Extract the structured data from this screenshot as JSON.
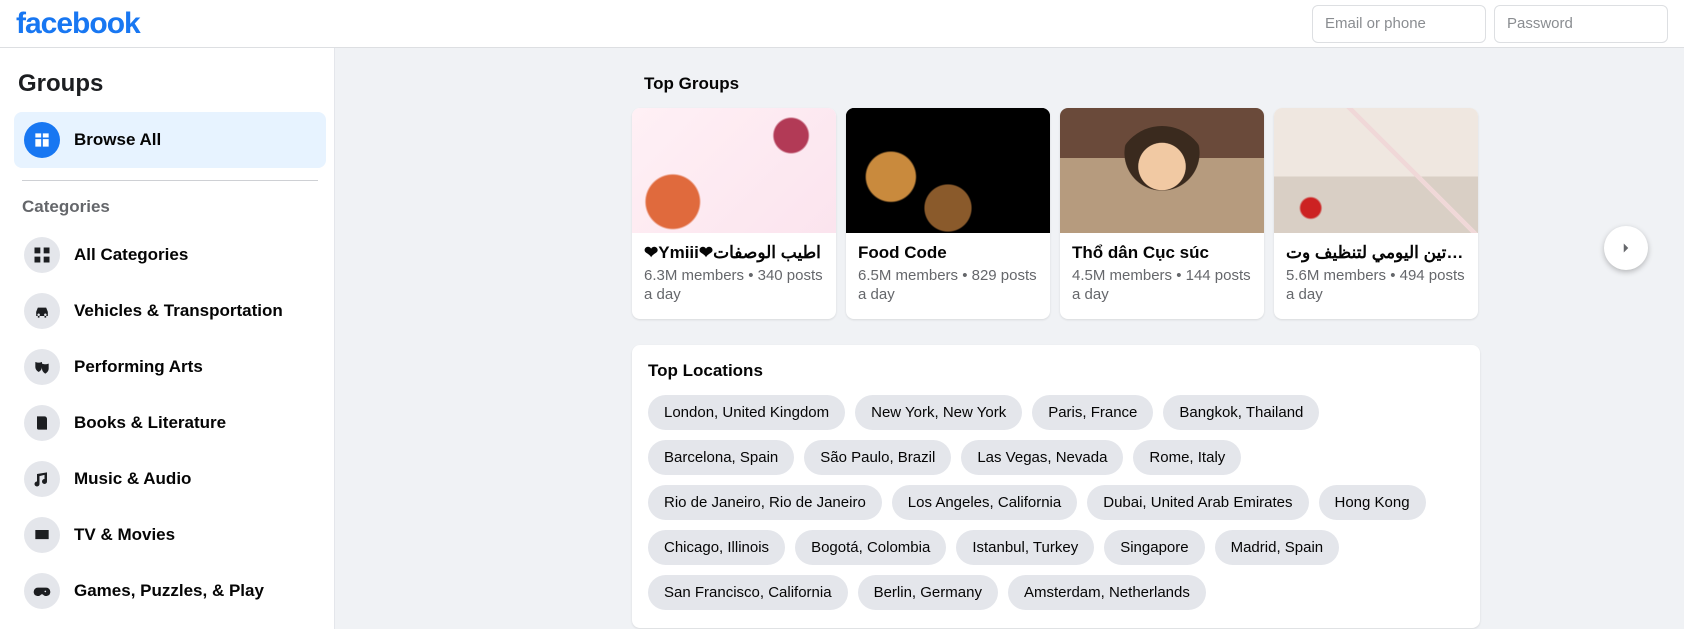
{
  "brand": "facebook",
  "login": {
    "email_placeholder": "Email or phone",
    "password_placeholder": "Password"
  },
  "sidebar": {
    "title": "Groups",
    "browse_all": "Browse All",
    "categories_label": "Categories",
    "categories": [
      {
        "label": "All Categories",
        "icon": "grid"
      },
      {
        "label": "Vehicles & Transportation",
        "icon": "car"
      },
      {
        "label": "Performing Arts",
        "icon": "masks"
      },
      {
        "label": "Books & Literature",
        "icon": "book"
      },
      {
        "label": "Music & Audio",
        "icon": "music"
      },
      {
        "label": "TV & Movies",
        "icon": "tv"
      },
      {
        "label": "Games, Puzzles, & Play",
        "icon": "game"
      }
    ]
  },
  "top_groups": {
    "heading": "Top Groups",
    "items": [
      {
        "title": "❤Ymiii❤اطيب الوصفات",
        "meta": "6.3M members • 340 posts a day"
      },
      {
        "title": "Food Code",
        "meta": "6.5M members • 829 posts a day"
      },
      {
        "title": "Thổ dân Cục súc",
        "meta": "4.5M members • 144 posts a day"
      },
      {
        "title": "الروتين اليومي لتنظيف وت...",
        "meta": "5.6M members • 494 posts a day"
      }
    ]
  },
  "top_locations": {
    "heading": "Top Locations",
    "items": [
      "London, United Kingdom",
      "New York, New York",
      "Paris, France",
      "Bangkok, Thailand",
      "Barcelona, Spain",
      "São Paulo, Brazil",
      "Las Vegas, Nevada",
      "Rome, Italy",
      "Rio de Janeiro, Rio de Janeiro",
      "Los Angeles, California",
      "Dubai, United Arab Emirates",
      "Hong Kong",
      "Chicago, Illinois",
      "Bogotá, Colombia",
      "Istanbul, Turkey",
      "Singapore",
      "Madrid, Spain",
      "San Francisco, California",
      "Berlin, Germany",
      "Amsterdam, Netherlands"
    ]
  }
}
